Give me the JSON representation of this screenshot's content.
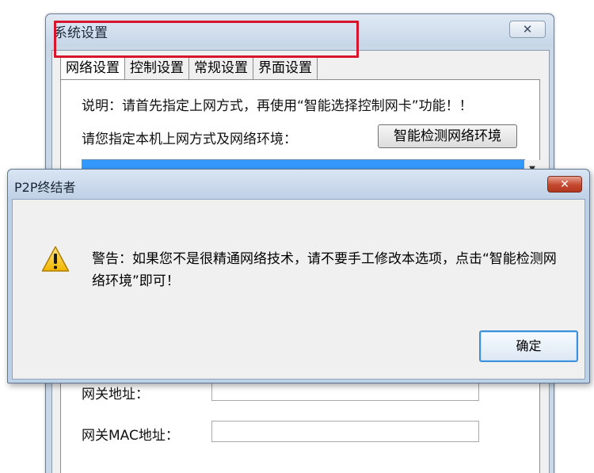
{
  "settings_window": {
    "title": "系统设置",
    "close_label": "✕",
    "tabs": [
      {
        "label": "网络设置",
        "active": true
      },
      {
        "label": "控制设置",
        "active": false
      },
      {
        "label": "常规设置",
        "active": false
      },
      {
        "label": "界面设置",
        "active": false
      }
    ],
    "description": "说明：请首先指定上网方式，再使用“智能选择控制网卡”功能！！",
    "prompt": "请您指定本机上网方式及网络环境：",
    "detect_button": "智能检测网络环境",
    "select_arrow": "▼",
    "fields": [
      {
        "label": "网关地址：",
        "value": ""
      },
      {
        "label": "网关MAC地址：",
        "value": ""
      }
    ],
    "highlight_color": "#d7152d"
  },
  "alert_dialog": {
    "title": "P2P终结者",
    "close_label": "✕",
    "icon": "warning-icon",
    "message": "警告：如果您不是很精通网络技术，请不要手工修改本选项，点击“智能检测网络环境”即可！",
    "ok_button": "确定"
  }
}
